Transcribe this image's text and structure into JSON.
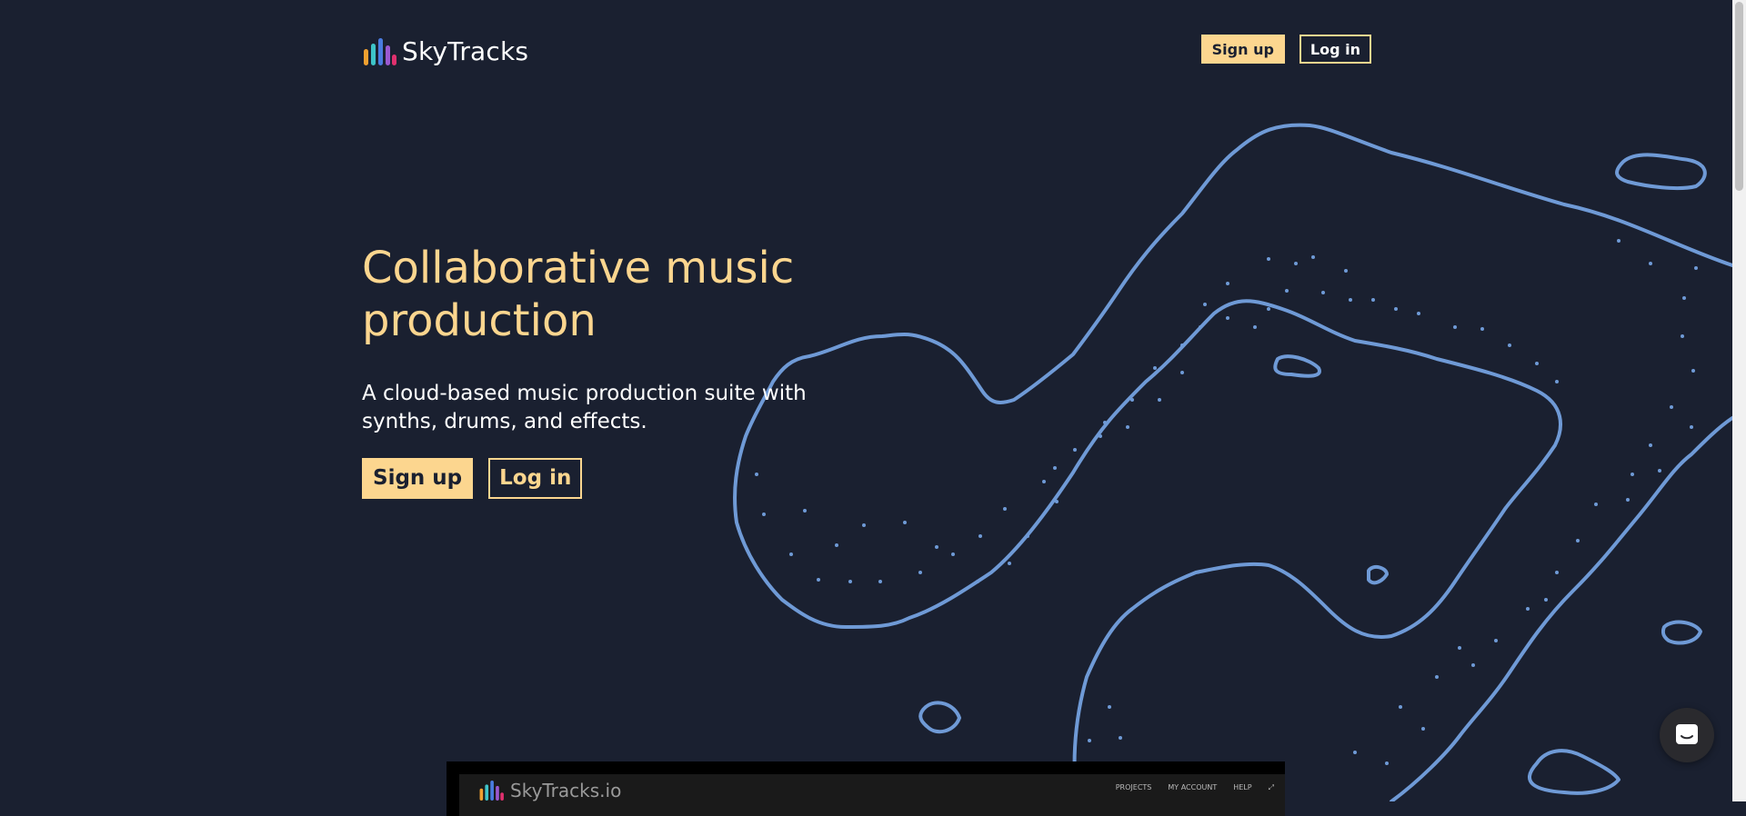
{
  "brand": {
    "name": "SkyTracks"
  },
  "header": {
    "signup_label": "Sign up",
    "login_label": "Log in"
  },
  "hero": {
    "title": "Collaborative music production",
    "subtitle": "A cloud-based music production suite with synths, drums, and effects.",
    "signup_label": "Sign up",
    "login_label": "Log in"
  },
  "preview": {
    "brand": "SkyTracks.io",
    "nav": [
      "PROJECTS",
      "MY ACCOUNT",
      "HELP"
    ]
  },
  "icons": {
    "chat": "chat-icon",
    "expand": "expand-icon",
    "logo": "equalizer-bars-icon"
  },
  "colors": {
    "background": "#1a2030",
    "accent": "#fcd68f",
    "wave": "#6f9ad6"
  }
}
